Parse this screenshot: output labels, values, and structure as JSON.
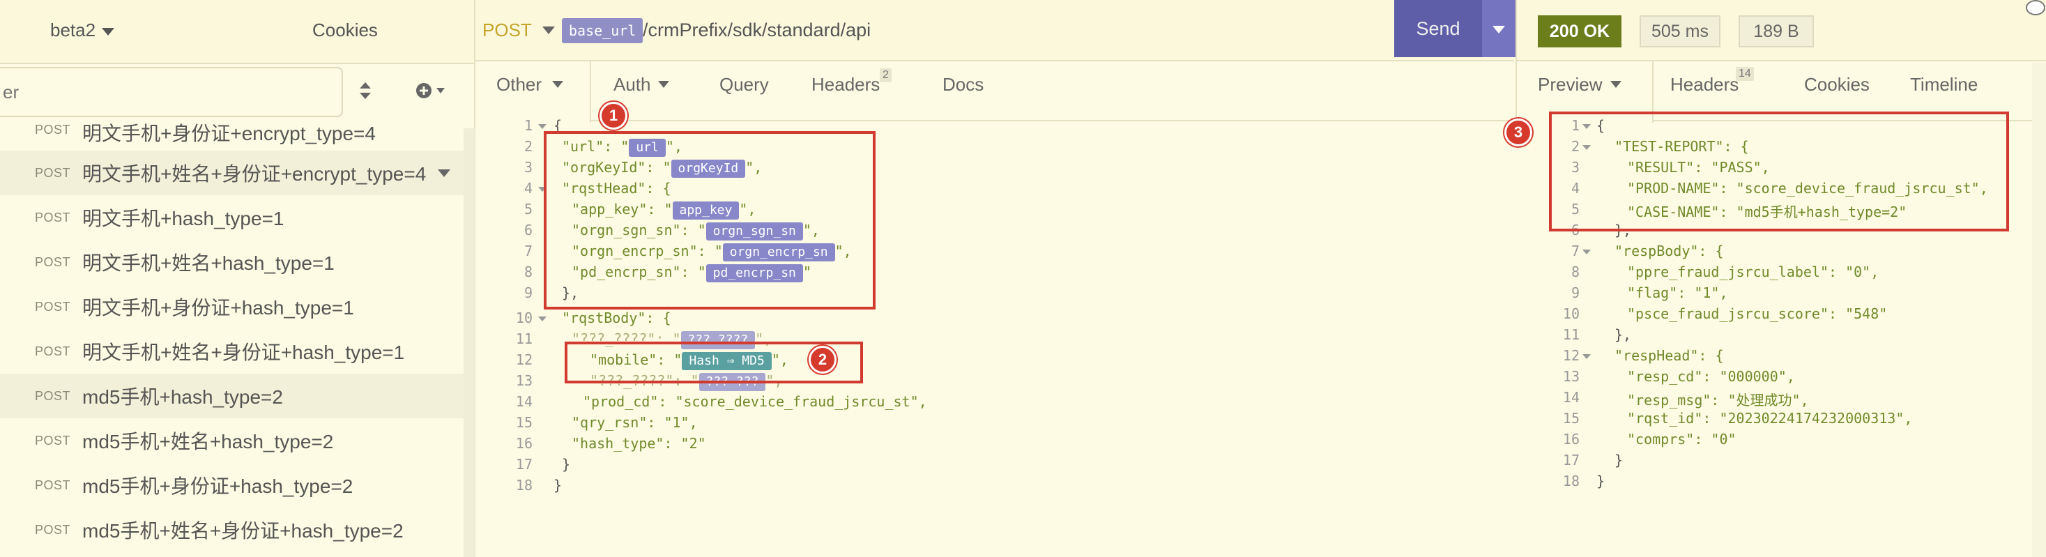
{
  "sidebar": {
    "environment": "beta2",
    "cookies": "Cookies",
    "filter_placeholder": "er",
    "requests": [
      {
        "method": "POST",
        "name": "明文手机+身份证+encrypt_type=4"
      },
      {
        "method": "POST",
        "name": "明文手机+姓名+身份证+encrypt_type=4"
      },
      {
        "method": "POST",
        "name": "明文手机+hash_type=1"
      },
      {
        "method": "POST",
        "name": "明文手机+姓名+hash_type=1"
      },
      {
        "method": "POST",
        "name": "明文手机+身份证+hash_type=1"
      },
      {
        "method": "POST",
        "name": "明文手机+姓名+身份证+hash_type=1"
      },
      {
        "method": "POST",
        "name": "md5手机+hash_type=2"
      },
      {
        "method": "POST",
        "name": "md5手机+姓名+hash_type=2"
      },
      {
        "method": "POST",
        "name": "md5手机+身份证+hash_type=2"
      },
      {
        "method": "POST",
        "name": "md5手机+姓名+身份证+hash_type=2"
      }
    ]
  },
  "request": {
    "method": "POST",
    "url_var": "base_url",
    "url_path": "/crmPrefix/sdk/standard/api",
    "send_label": "Send",
    "tabs": {
      "other": "Other",
      "auth": "Auth",
      "query": "Query",
      "headers": "Headers",
      "headers_count": "2",
      "docs": "Docs"
    },
    "body": {
      "l1": "{",
      "l2_key": "\"url\": \"",
      "l2_var": "url",
      "l2_end": "\",",
      "l3_key": "\"orgKeyId\": \"",
      "l3_var": "orgKeyId",
      "l3_end": "\",",
      "l4": "\"rqstHead\": {",
      "l5_key": "\"app_key\": \"",
      "l5_var": "app_key",
      "l5_end": "\",",
      "l6_key": "\"orgn_sgn_sn\": \"",
      "l6_var": "orgn_sgn_sn",
      "l6_end": "\",",
      "l7_key": "\"orgn_encrp_sn\": \"",
      "l7_var": "orgn_encrp_sn",
      "l7_end": "\",",
      "l8_key": "\"pd_encrp_sn\": \"",
      "l8_var": "pd_encrp_sn",
      "l8_end": "\"",
      "l9": "},",
      "l10": "\"rqstBody\": {",
      "l11_key": "\"???_????\": \"",
      "l11_var": "??? ????",
      "l11_end": "\",",
      "l12_key": "\"mobile\": \"",
      "l12_var": "Hash ⇒ MD5",
      "l12_end": "\",",
      "l13_key": "\"???_????\": \"",
      "l13_var": "??? ???",
      "l13_end": "\",",
      "l14": "\"prod_cd\": \"score_device_fraud_jsrcu_st\",",
      "l15": "\"qry_rsn\": \"1\",",
      "l16": "\"hash_type\": \"2\"",
      "l17": "}",
      "l18": "}"
    }
  },
  "response": {
    "status": "200 OK",
    "time": "505 ms",
    "size": "189 B",
    "tabs": {
      "preview": "Preview",
      "headers": "Headers",
      "headers_count": "14",
      "cookies": "Cookies",
      "timeline": "Timeline"
    },
    "body": {
      "l1": "{",
      "l2": "\"TEST-REPORT\": {",
      "l3": "\"RESULT\": \"PASS\",",
      "l4": "\"PROD-NAME\": \"score_device_fraud_jsrcu_st\",",
      "l5": "\"CASE-NAME\": \"md5手机+hash_type=2\"",
      "l6": "},",
      "l7": "\"respBody\": {",
      "l8": "\"ppre_fraud_jsrcu_label\": \"0\",",
      "l9": "\"flag\": \"1\",",
      "l10": "\"psce_fraud_jsrcu_score\": \"548\"",
      "l11": "},",
      "l12": "\"respHead\": {",
      "l13": "\"resp_cd\": \"000000\",",
      "l14": "\"resp_msg\": \"处理成功\",",
      "l15": "\"rqst_id\": \"20230224174232000313\",",
      "l16": "\"comprs\": \"0\"",
      "l17": "}",
      "l18": "}"
    }
  },
  "annotations": [
    "1",
    "2",
    "3"
  ],
  "colors": {
    "send": "#5e5ea8",
    "status_ok": "#6c7d1c",
    "annotation": "#d13a2f",
    "variable_tag": "#8787c9"
  }
}
